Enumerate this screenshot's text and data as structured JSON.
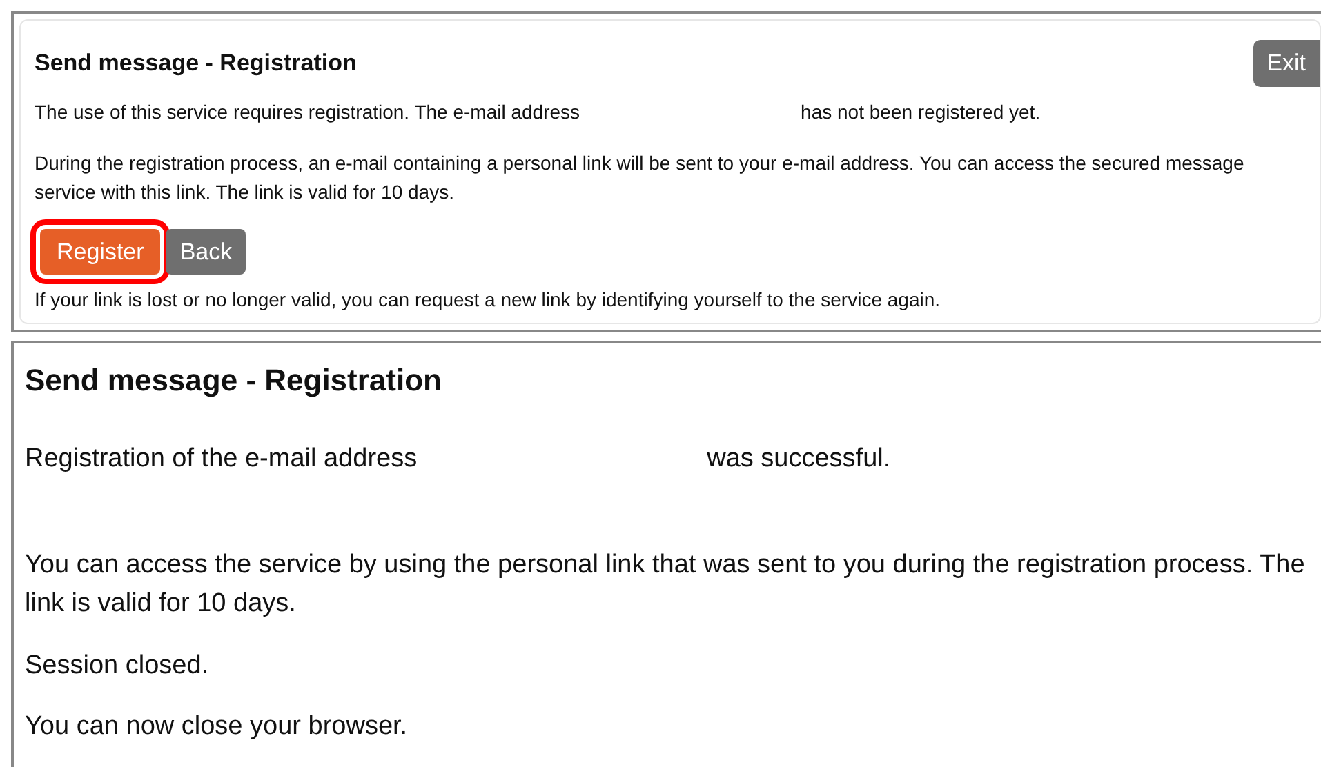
{
  "dialog": {
    "title": "Send message - Registration",
    "exit_button": "Exit",
    "intro_before": "The use of this service requires registration. The e-mail address",
    "intro_after": "has not been registered yet.",
    "info": "During the registration process, an e-mail containing a personal link will be sent to your e-mail address. You can access the secured message service with this link. The link is valid for 10 days.",
    "buttons": [
      {
        "label": "Register",
        "kind": "primary",
        "highlighted": true
      },
      {
        "label": "Back",
        "kind": "secondary",
        "highlighted": false
      }
    ],
    "footer": "If your link is lost or no longer valid, you can request a new link by identifying yourself to the service again."
  },
  "result": {
    "title": "Send message - Registration",
    "line_before": "Registration of the e-mail address",
    "line_after": "was successful.",
    "paragraphs": [
      "You can access the service by using the personal link that was sent to you during the registration process. The link is valid for 10 days.",
      "Session closed.",
      "You can now close your browser."
    ]
  }
}
